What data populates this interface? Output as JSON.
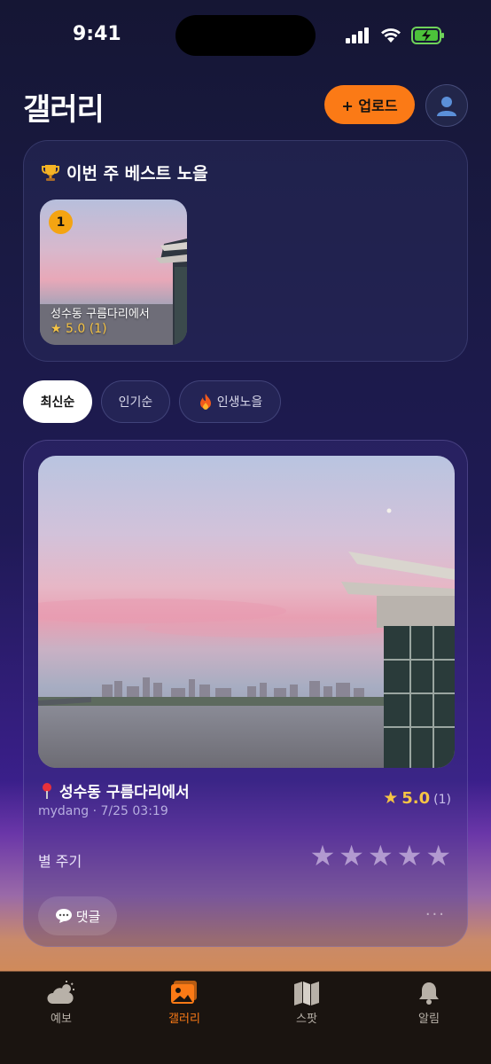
{
  "status_bar": {
    "time": "9:41"
  },
  "header": {
    "title": "갤러리",
    "upload_label": "+ 업로드"
  },
  "best": {
    "title": "이번 주 베스트 노을",
    "items": [
      {
        "rank": "1",
        "location": "성수동 구름다리에서",
        "rating": "★ 5.0 (1)"
      }
    ]
  },
  "filters": [
    {
      "label": "최신순",
      "active": true
    },
    {
      "label": "인기순",
      "active": false
    },
    {
      "label": "인생노을",
      "active": false
    }
  ],
  "post": {
    "location": "성수동 구름다리에서",
    "meta": "mydang · 7/25 03:19",
    "rating": "5.0",
    "rating_count": "(1)",
    "rate_label": "별 주기",
    "comment_label": "댓글",
    "more_label": "···"
  },
  "tabs": [
    {
      "label": "예보",
      "icon": "weather-icon"
    },
    {
      "label": "갤러리",
      "icon": "gallery-icon",
      "active": true
    },
    {
      "label": "스팟",
      "icon": "map-icon"
    },
    {
      "label": "알림",
      "icon": "bell-icon"
    }
  ],
  "colors": {
    "accent": "#fb7a16",
    "star": "#f6c445",
    "badge": "#f4a412"
  }
}
